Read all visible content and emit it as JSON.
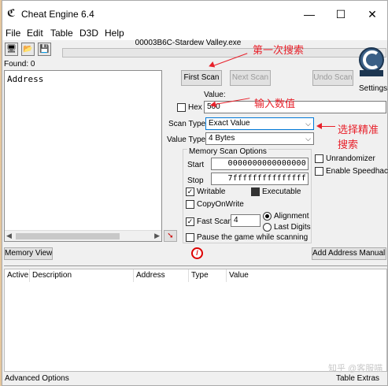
{
  "window": {
    "title": "Cheat Engine 6.4",
    "minimize": "—",
    "maximize": "☐",
    "close": "✕",
    "app_icon": "ce-logo-icon"
  },
  "menu": [
    "File",
    "Edit",
    "Table",
    "D3D",
    "Help"
  ],
  "toolbar": {
    "open_process_icon": "computer-icon",
    "open_file_icon": "folder-icon",
    "save_icon": "floppy-icon"
  },
  "process": {
    "name": "00003B6C-Stardew Valley.exe"
  },
  "results": {
    "found": "Found: 0",
    "header": "Address"
  },
  "scan": {
    "first_scan": "First Scan",
    "next_scan": "Next Scan",
    "undo_scan": "Undo Scan",
    "settings": "Settings",
    "value_label": "Value:",
    "hex_label": "Hex",
    "value": "500",
    "scan_type_label": "Scan Type",
    "scan_type": "Exact Value",
    "value_type_label": "Value Type",
    "value_type": "4 Bytes",
    "memory_options_label": "Memory Scan Options",
    "start_label": "Start",
    "start_value": "0000000000000000",
    "stop_label": "Stop",
    "stop_value": "7fffffffffffffff",
    "writable": "Writable",
    "executable": "Executable",
    "copyonwrite": "CopyOnWrite",
    "fast_scan": "Fast Scan",
    "fast_scan_value": "4",
    "alignment": "Alignment",
    "last_digits": "Last Digits",
    "pause": "Pause the game while scanning",
    "unrandomizer": "Unrandomizer",
    "speedhack": "Enable Speedhack"
  },
  "buttons": {
    "memory_view": "Memory View",
    "add_address": "Add Address Manually"
  },
  "table": {
    "columns": [
      "Active",
      "Description",
      "Address",
      "Type",
      "Value"
    ]
  },
  "footer": {
    "advanced_options": "Advanced Options",
    "table_extras": "Table Extras"
  },
  "annotations": {
    "first_search": "第一次搜索",
    "enter_value": "输入数值",
    "choose_exact_line1": "选择精准",
    "choose_exact_line2": "搜索"
  },
  "watermark": "知乎 @客服喵",
  "colors": {
    "annotation": "#e8202a",
    "accent": "#0078d7"
  }
}
